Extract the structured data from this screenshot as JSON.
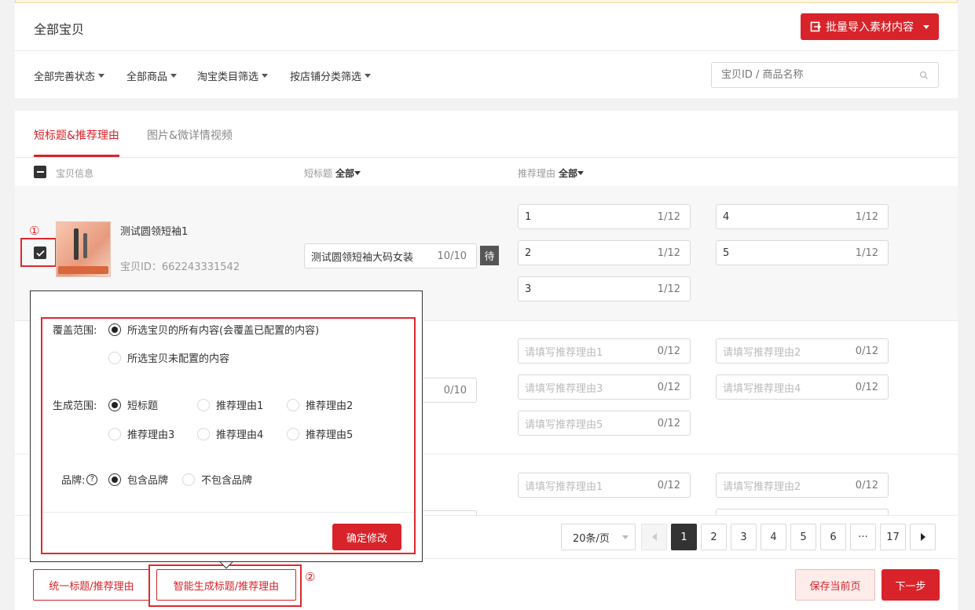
{
  "header": {
    "title": "全部宝贝",
    "import_label": "批量导入素材内容"
  },
  "filters": [
    "全部完善状态",
    "全部商品",
    "淘宝类目筛选",
    "按店铺分类筛选"
  ],
  "search": {
    "placeholder": "宝贝ID / 商品名称"
  },
  "tabs": [
    {
      "label": "短标题&推荐理由",
      "active": true
    },
    {
      "label": "图片&微详情视频",
      "active": false
    }
  ],
  "columns": {
    "info": "宝贝信息",
    "short_title": "短标题",
    "short_title_filter": "全部",
    "reason": "推荐理由",
    "reason_filter": "全部"
  },
  "rows": [
    {
      "name": "测试圆领短袖1",
      "id_label": "宝贝ID：662243331542",
      "short_title": "测试圆领短袖大码女装",
      "short_count": "10/10",
      "status": "待",
      "reasons": [
        {
          "value": "1",
          "count": "1/12"
        },
        {
          "value": "4",
          "count": "1/12"
        },
        {
          "value": "2",
          "count": "1/12"
        },
        {
          "value": "5",
          "count": "1/12"
        },
        {
          "value": "3",
          "count": "1/12"
        }
      ]
    },
    {
      "short_count": "0/10",
      "reasons": [
        {
          "placeholder": "请填写推荐理由1",
          "count": "0/12"
        },
        {
          "placeholder": "请填写推荐理由2",
          "count": "0/12"
        },
        {
          "placeholder": "请填写推荐理由3",
          "count": "0/12"
        },
        {
          "placeholder": "请填写推荐理由4",
          "count": "0/12"
        },
        {
          "placeholder": "请填写推荐理由5",
          "count": "0/12"
        }
      ]
    },
    {
      "reasons": [
        {
          "placeholder": "请填写推荐理由1",
          "count": "0/12"
        },
        {
          "placeholder": "请填写推荐理由2",
          "count": "0/12"
        }
      ]
    }
  ],
  "popup": {
    "cover_label": "覆盖范围:",
    "cover_options": [
      "所选宝贝的所有内容(会覆盖已配置的内容)",
      "所选宝贝未配置的内容"
    ],
    "gen_label": "生成范围:",
    "gen_options": [
      "短标题",
      "推荐理由1",
      "推荐理由2",
      "推荐理由3",
      "推荐理由4",
      "推荐理由5"
    ],
    "brand_label": "品牌:",
    "brand_options": [
      "包含品牌",
      "不包含品牌"
    ],
    "confirm_label": "确定修改"
  },
  "pagination": {
    "page_size": "20条/页",
    "pages": [
      "1",
      "2",
      "3",
      "4",
      "5",
      "6",
      "···",
      "17"
    ],
    "current": "1"
  },
  "footer": {
    "unify_label": "统一标题/推荐理由",
    "smart_label": "智能生成标题/推荐理由",
    "save_label": "保存当前页",
    "next_label": "下一步"
  },
  "annotations": [
    "①",
    "②"
  ],
  "colors": {
    "accent": "#d9232a",
    "dark": "#333333"
  }
}
